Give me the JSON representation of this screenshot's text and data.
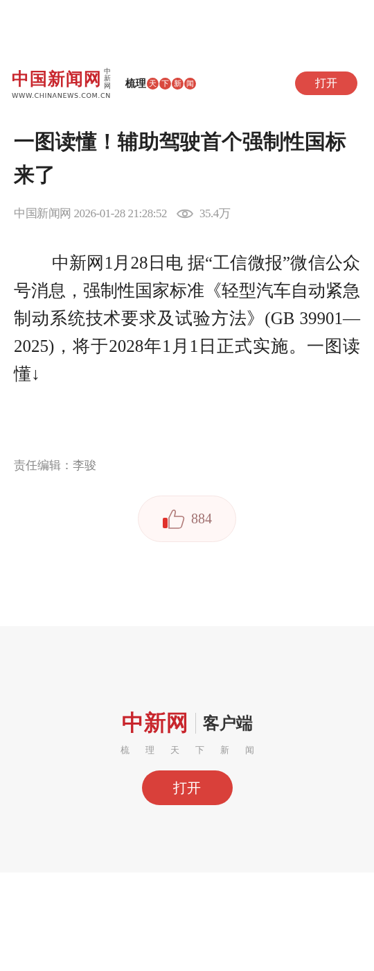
{
  "header": {
    "logo": "中国新闻网",
    "logo_side": "中新网",
    "logo_url": "WWW.CHINANEWS.COM.CN",
    "slogan_lead": "梳理",
    "slogan_marks": [
      "天",
      "下",
      "新",
      "闻"
    ],
    "open_button": "打开"
  },
  "article": {
    "title": "一图读懂！辅助驾驶首个强制性国标来了",
    "source": "中国新闻网",
    "time": "2026-01-28 21:28:52",
    "views": "35.4万",
    "body": "中新网1月28日电 据“工信微报”微信公众号消息，强制性国家标准《轻型汽车自动紧急制动系统技术要求及试验方法》(GB 39901—2025)，将于2028年1月1日正式实施。一图读懂↓",
    "editor": "责任编辑：李骏",
    "likes": "884"
  },
  "footer": {
    "logo": "中新网",
    "app_label": "客户端",
    "tagline": [
      "梳",
      "理",
      "天",
      "下",
      "新",
      "闻"
    ],
    "open_button": "打开"
  }
}
